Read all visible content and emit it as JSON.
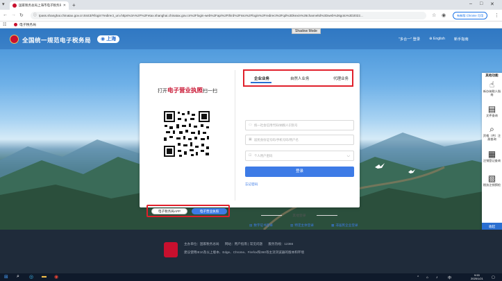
{
  "browser": {
    "tab_title": "国家税务总局上海市电子税务局",
    "url": "tpass.shanghai.chinatax.gov.cn:8443/#/login?redirect_uri=https%3A%2F%2Fetax.shanghai.chinatax.gov.cn%2Flogin-web%2Fapi%2Fthird%2Fsso%2Flogin%2Fredirect%3Fqd%3Dkexin%26channelId%3Dweb%26goto%3D2022...",
    "extension_button": "有新版 Chrome 可用",
    "bookmark": "电子税务局",
    "shadow_mode": "Shadow Mode"
  },
  "header": {
    "site_title": "全国统一规范电子税务局",
    "region": "上海",
    "nav": [
      "\"多合一\" 登录",
      "English",
      "新手指南"
    ]
  },
  "qr_panel": {
    "title_prefix": "打开",
    "title_highlight": "电子营业执照",
    "title_suffix": "扫一扫",
    "app_options": [
      "电子税务局APP",
      "电子营业执照"
    ]
  },
  "login": {
    "tabs": [
      "企业业务",
      "自然人业务",
      "代理业务"
    ],
    "field_credit_code": "统一社会信用代码/纳税人识别号",
    "field_id_number": "居民身份证号码/手机号码/用户名",
    "field_password": "个人用户密码",
    "login_button": "登录",
    "forgot_password": "忘记密码",
    "other_login_label": "其他登录",
    "other_logins": [
      "数字证书登录",
      "特定主体登录",
      "非居民企业登录"
    ]
  },
  "side_tools": {
    "title": "其他功能",
    "items": [
      "新办纳税人指南",
      "文件查询",
      "资格（件）注册查询",
      "注销登记查询",
      "税务注销预检"
    ],
    "collapse": "收起"
  },
  "footer": {
    "line1": [
      "主办单位：国家税务总局",
      "网站：用户指南 | 常见问题",
      "服务热线：12366"
    ],
    "line2": "建议使用IE10及以上版本、Edge、Chrome、Firefox和360等主流浏览器的版本和环境"
  },
  "taskbar": {
    "time": "9:53",
    "date": "2025/1/21"
  },
  "colors": {
    "primary_blue": "#3d7be6",
    "highlight_red": "#e0202b",
    "brand_red": "#c8102e"
  }
}
